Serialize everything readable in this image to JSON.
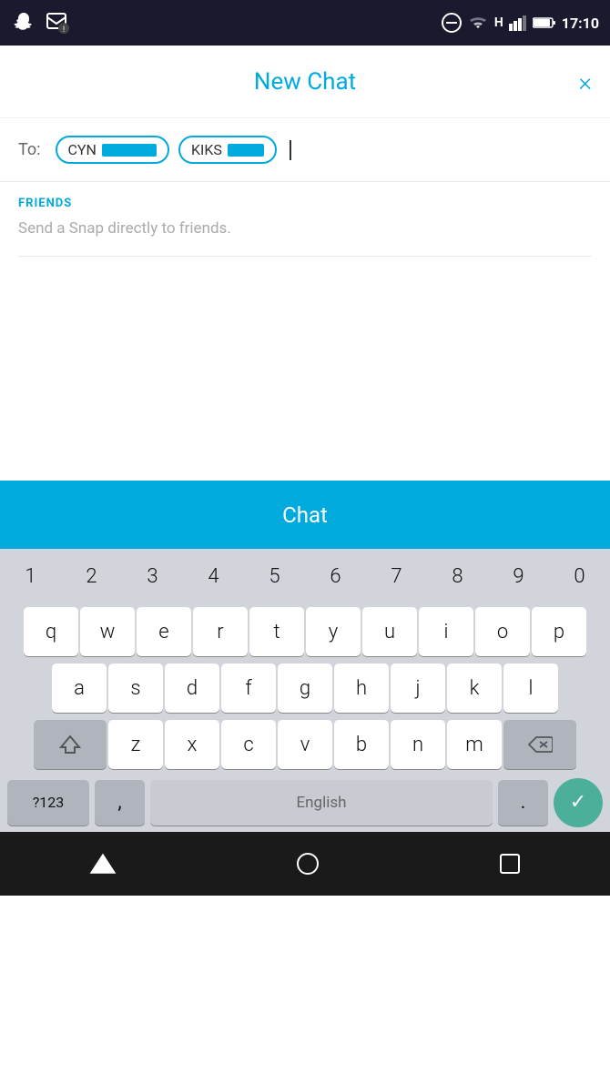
{
  "statusBar": {
    "time": "17:10",
    "icons": [
      "snapchat",
      "notification"
    ]
  },
  "header": {
    "title": "New Chat",
    "closeLabel": "×"
  },
  "toField": {
    "label": "To:",
    "recipients": [
      {
        "prefix": "CYN",
        "id": "recipient-1"
      },
      {
        "prefix": "KIKS",
        "id": "recipient-2"
      }
    ]
  },
  "friendsSection": {
    "heading": "FRIENDS",
    "hint": "Send a Snap directly to friends."
  },
  "chatButton": {
    "label": "Chat"
  },
  "keyboard": {
    "numbers": [
      "1",
      "2",
      "3",
      "4",
      "5",
      "6",
      "7",
      "8",
      "9",
      "0"
    ],
    "row1": [
      "q",
      "w",
      "e",
      "r",
      "t",
      "y",
      "u",
      "i",
      "o",
      "p"
    ],
    "row2": [
      "a",
      "s",
      "d",
      "f",
      "g",
      "h",
      "j",
      "k",
      "l"
    ],
    "row3": [
      "z",
      "x",
      "c",
      "v",
      "b",
      "n",
      "m"
    ],
    "bottomRow": {
      "special": "?123",
      "comma": ",",
      "space": "English",
      "period": ".",
      "checkmark": "✓"
    }
  },
  "navBar": {
    "back": "▽",
    "home": "○",
    "recent": "□"
  }
}
